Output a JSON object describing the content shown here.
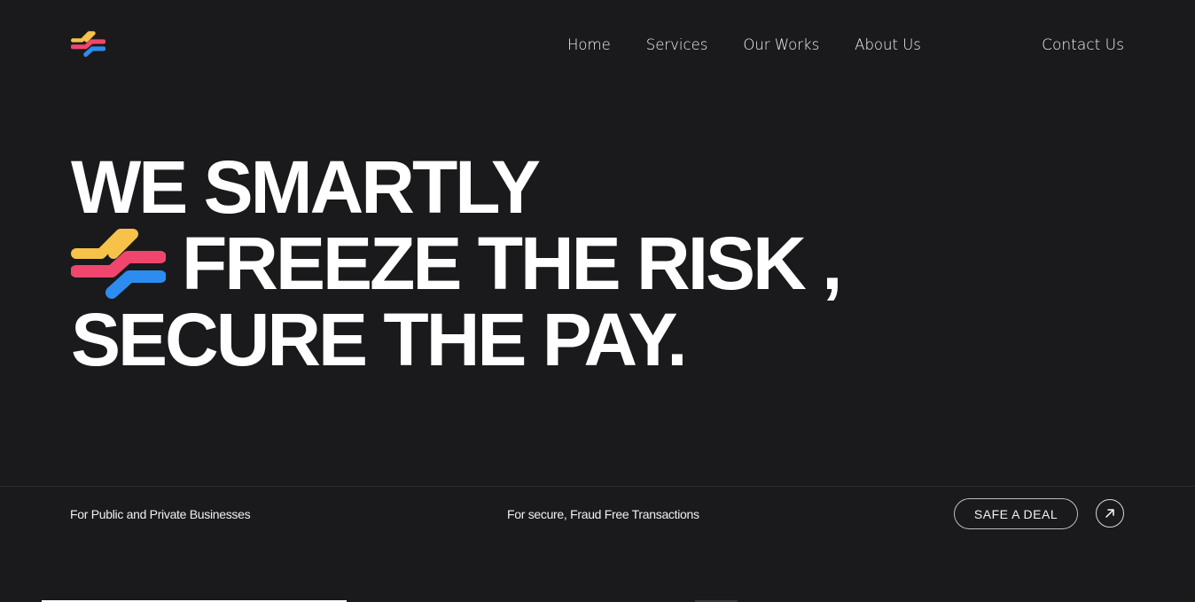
{
  "nav": {
    "items": [
      {
        "label": "Home"
      },
      {
        "label": "Services"
      },
      {
        "label": "Our Works"
      },
      {
        "label": "About Us"
      }
    ],
    "contact_label": "Contact Us"
  },
  "hero": {
    "line1": "WE SMARTLY",
    "line2": "FREEZE THE RISK ,",
    "line3": "SECURE THE PAY."
  },
  "strip": {
    "tagline_left": "For Public and Private Businesses",
    "tagline_center": "For secure, Fraud Free Transactions",
    "cta_label": "SAFE A DEAL"
  },
  "icons": {
    "logo": "brand-waves-icon",
    "hero_mark": "brand-waves-icon",
    "cta_arrow": "arrow-up-right-icon"
  },
  "colors": {
    "background": "#1a1a1c",
    "brand_yellow": "#f7c24a",
    "brand_pink": "#f0466e",
    "brand_blue": "#2d8cf0"
  }
}
